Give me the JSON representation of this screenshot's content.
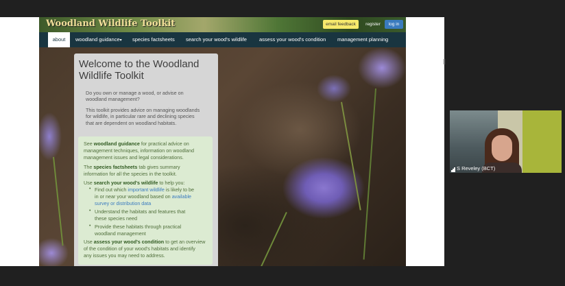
{
  "participant": {
    "name": "S Reveley (BCT)"
  },
  "site": {
    "title": "Woodland Wildlife Toolkit",
    "header_buttons": {
      "feedback": "email feedback",
      "register": "register",
      "login": "log in"
    },
    "nav": [
      "about",
      "woodland guidance",
      "species factsheets",
      "search your wood's wildlife",
      "assess your wood's condition",
      "management planning"
    ],
    "dropdown_caret": "▾",
    "welcome": {
      "heading_line1": "Welcome to the Woodland",
      "heading_line2": "Wildlife Toolkit",
      "p1_line1": "Do you own or manage a wood, or advise on",
      "p1_line2": "woodland management?",
      "p2_line1": "This toolkit provides advice on managing woodlands",
      "p2_line2": "for wildlife, in particular rare and declining species",
      "p2_line3": "that are dependent on woodland habitats."
    },
    "guide": {
      "l1_a": "See ",
      "l1_b": "woodland guidance",
      "l1_c": " for practical advice on",
      "l2": "management techniques, information on woodland",
      "l3": "management issues and legal considerations.",
      "l4_a": "The ",
      "l4_b": "species factsheets",
      "l4_c": " tab gives summary",
      "l5": "information for all the species in the toolkit.",
      "l6_a": "Use ",
      "l6_b": "search your wood's wildlife",
      "l6_c": " to help you:",
      "b1_a": "Find out which ",
      "b1_b": "important wildlife",
      "b1_c": " is likely to be",
      "b1_l2_a": "in or near your woodland based on ",
      "b1_l2_b": "available",
      "b1_l3": "survey or distribution data",
      "b2_l1": "Understand the habitats and features that",
      "b2_l2": "these species need",
      "b3_l1": "Provide these habitats through practical",
      "b3_l2": "woodland management",
      "l7_a": "Use ",
      "l7_b": "assess your wood's condition",
      "l7_c": " to get an overview",
      "l8": "of the condition of your wood's habitats and identify",
      "l9": "any issues you may need to address."
    },
    "colors": {
      "nav_bg": "#193540",
      "login": "#3a7bbf",
      "feedback": "#f6ea6c",
      "guide_box": "#dcebd2"
    }
  }
}
